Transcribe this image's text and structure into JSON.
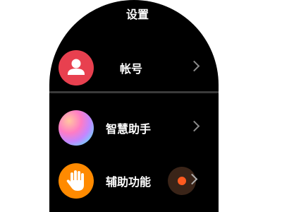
{
  "screen": {
    "title": "设置"
  },
  "rows": [
    {
      "label": "帐号",
      "icon": "user-icon",
      "icon_color": "#e8404f"
    },
    {
      "label": "智慧助手",
      "icon": "assistant-orb-icon"
    },
    {
      "label": "辅助功能",
      "icon": "hand-icon",
      "icon_color": "#ff8a00"
    }
  ],
  "colors": {
    "background": "#000000",
    "text": "#ffffff",
    "chevron": "#8a8a8a",
    "divider": "#3a3a3a",
    "floating_ball_dot": "#ff5a1f"
  }
}
